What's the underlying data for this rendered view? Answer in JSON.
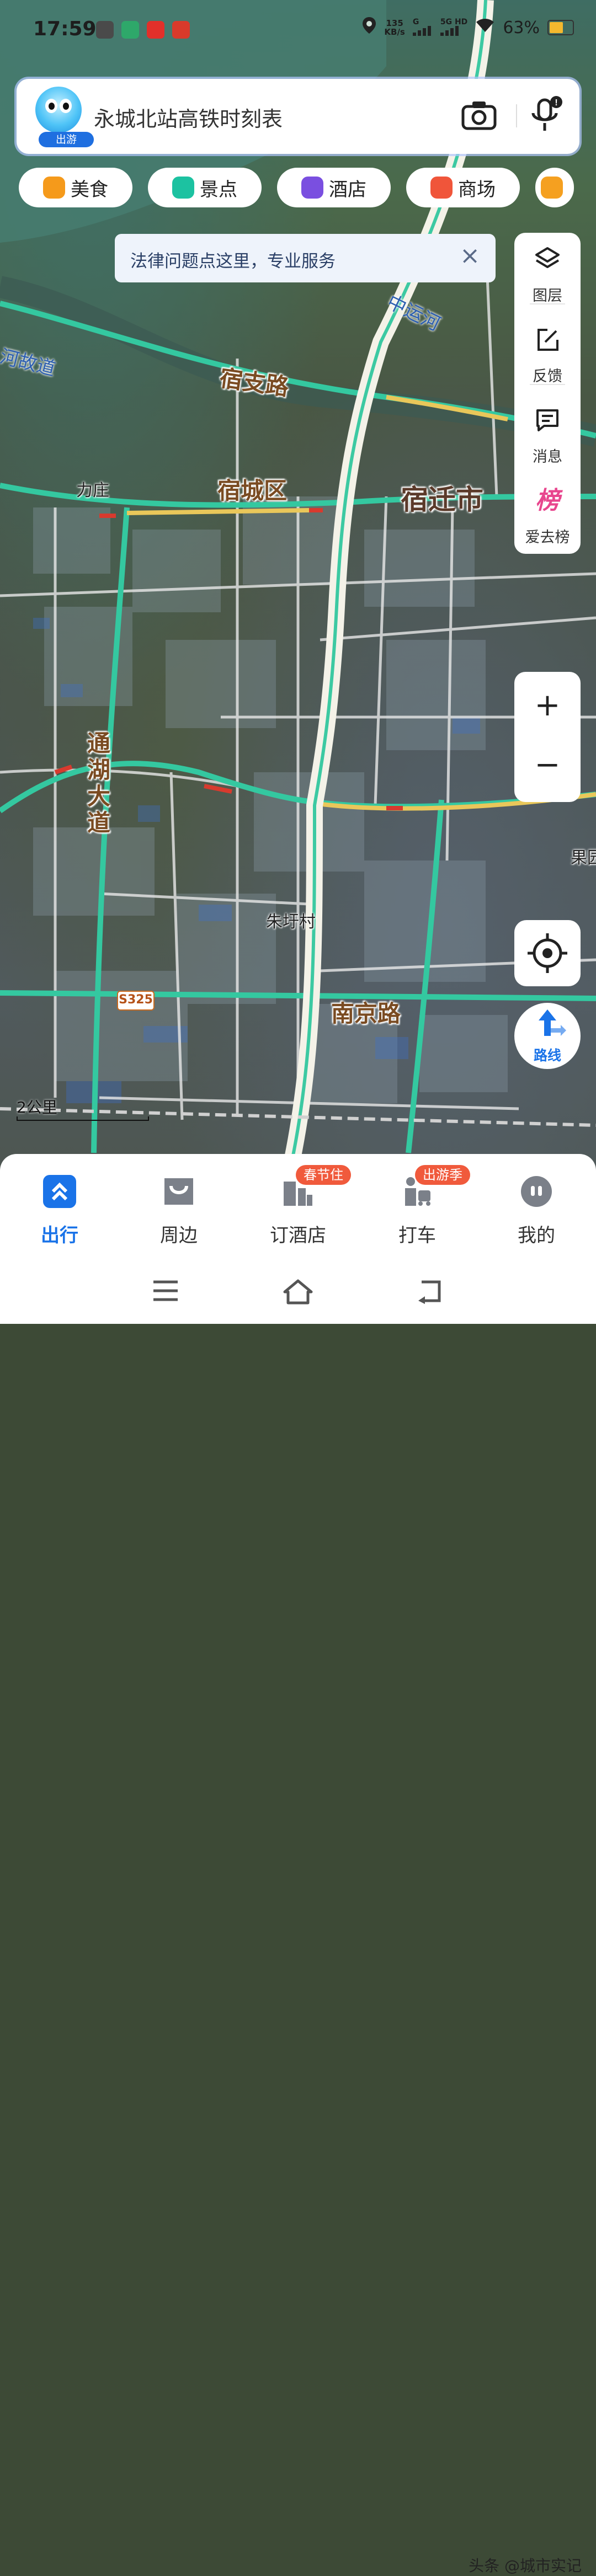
{
  "status_bar": {
    "time": "17:59",
    "net_speed_value": "135",
    "net_speed_unit": "KB/s",
    "signal_1": "G",
    "signal_2": "5G HD",
    "battery": "63%"
  },
  "search": {
    "mascot_badge": "出游",
    "placeholder": "永城北站高铁时刻表",
    "camera_icon": "camera-icon",
    "mic_icon": "microphone-icon"
  },
  "categories": [
    {
      "label": "美食",
      "color": "#f59a1b"
    },
    {
      "label": "景点",
      "color": "#1cc2a1"
    },
    {
      "label": "酒店",
      "color": "#7a4fe0"
    },
    {
      "label": "商场",
      "color": "#f0553a"
    }
  ],
  "notice": {
    "text": "法律问题点这里，专业服务",
    "close": "×"
  },
  "tools": [
    {
      "label": "图层",
      "icon": "layers-icon"
    },
    {
      "label": "反馈",
      "icon": "feedback-icon"
    },
    {
      "label": "消息",
      "icon": "message-icon"
    },
    {
      "label": "爱去榜",
      "icon": "ranking-icon",
      "glyph": "榜"
    }
  ],
  "zoom": {
    "plus": "+",
    "minus": "−"
  },
  "route": {
    "label": "路线"
  },
  "map": {
    "labels": {
      "canal_left": "河故道",
      "canal_right": "中运河",
      "road_suzhi": "宿支路",
      "town_lizhuang": "力庄",
      "district": "宿城区",
      "city": "宿迁市",
      "road_tonghu": "通湖大道",
      "village": "朱圩村",
      "road_nanjing": "南京路",
      "right_edge": "果园",
      "route_shield": "S325"
    },
    "scale": "2公里"
  },
  "bottom_nav": [
    {
      "label": "出行",
      "active": true
    },
    {
      "label": "周边",
      "active": false
    },
    {
      "label": "订酒店",
      "active": false,
      "badge": "春节住"
    },
    {
      "label": "打车",
      "active": false,
      "badge": "出游季"
    },
    {
      "label": "我的",
      "active": false
    }
  ],
  "watermark": "头条 @城市实记"
}
